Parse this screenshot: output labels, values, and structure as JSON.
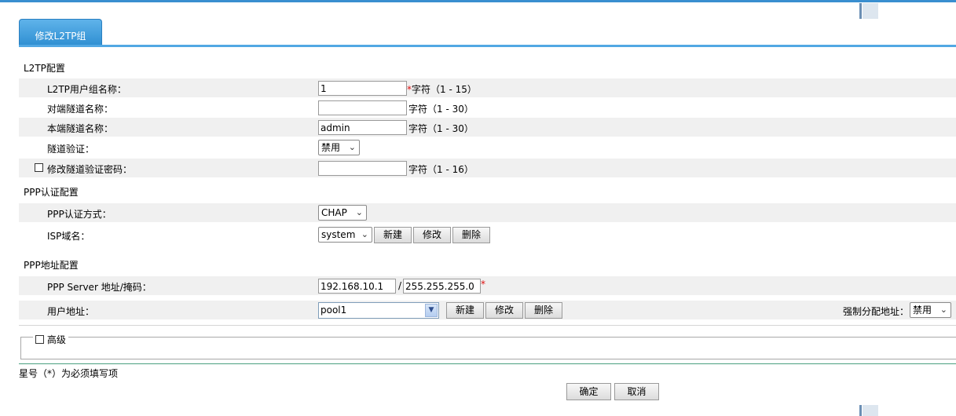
{
  "tab": {
    "label": "修改L2TP组"
  },
  "l2tp": {
    "section_title": "L2TP配置",
    "group_name": {
      "label": "L2TP用户组名称：",
      "value": "1",
      "star": "*",
      "hint": "字符（1 - 15）"
    },
    "peer_tunnel": {
      "label": "对端隧道名称：",
      "value": "",
      "hint": "字符（1 - 30）"
    },
    "local_tunnel": {
      "label": "本端隧道名称：",
      "value": "admin",
      "hint": "字符（1 - 30）"
    },
    "tunnel_auth": {
      "label": "隧道验证：",
      "value": "禁用"
    },
    "change_password": {
      "label": "修改隧道验证密码：",
      "value": "",
      "hint": "字符（1 - 16）",
      "checked": false
    }
  },
  "ppp_auth": {
    "section_title": "PPP认证配置",
    "method": {
      "label": "PPP认证方式：",
      "value": "CHAP"
    },
    "isp": {
      "label": "ISP域名：",
      "value": "system",
      "new_label": "新建",
      "edit_label": "修改",
      "delete_label": "删除"
    }
  },
  "ppp_addr": {
    "section_title": "PPP地址配置",
    "server": {
      "label": "PPP Server 地址/掩码：",
      "ip": "192.168.10.1",
      "sep": "/",
      "mask": "255.255.255.0",
      "star": "*"
    },
    "user_addr": {
      "label": "用户地址：",
      "value": "pool1",
      "new_label": "新建",
      "edit_label": "修改",
      "delete_label": "删除"
    },
    "force_assign": {
      "label": "强制分配地址：",
      "value": "禁用"
    }
  },
  "advanced": {
    "label": "高级",
    "checked": false
  },
  "footer": {
    "note": "星号（*）为必须填写项",
    "ok_label": "确定",
    "cancel_label": "取消"
  },
  "icons": {
    "dropdown": "chevron-down-icon",
    "combo": "dropdown-arrow-icon",
    "checkbox": "checkbox-icon"
  },
  "colors": {
    "accent": "#3a8fd0",
    "tab_bg": "#2f8fd2",
    "required": "#e01010"
  }
}
